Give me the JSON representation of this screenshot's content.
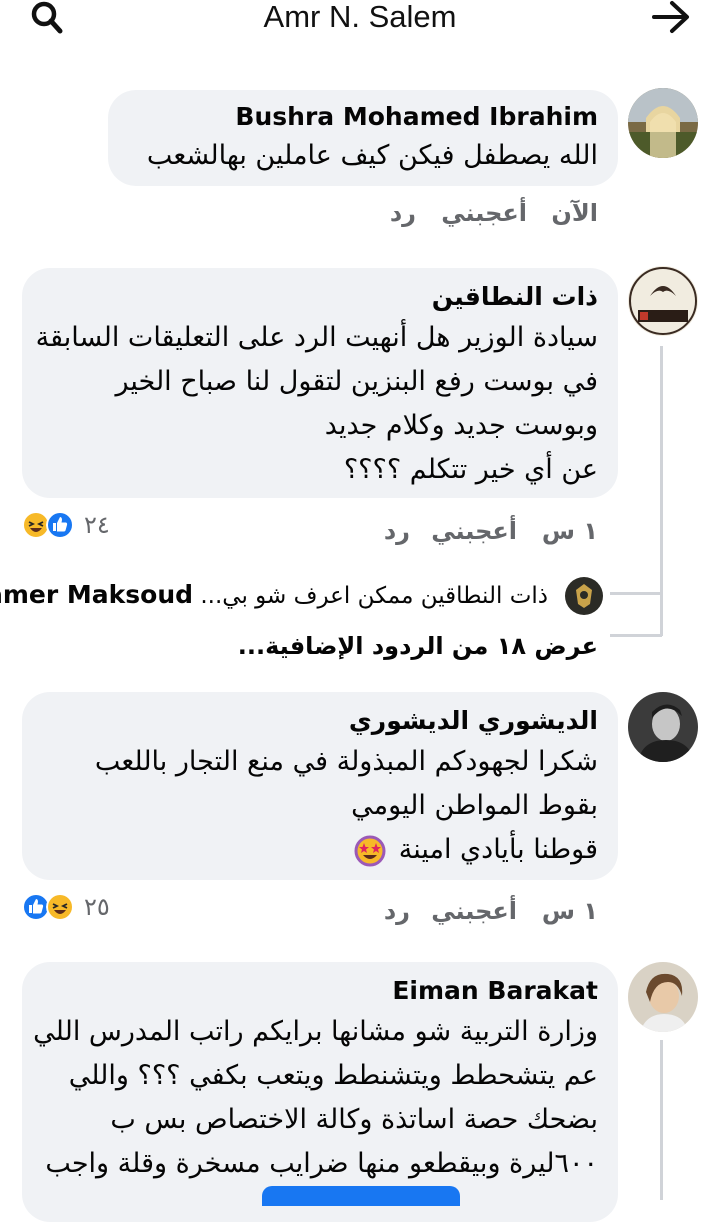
{
  "header": {
    "title": "Amr N. Salem"
  },
  "comments": [
    {
      "author": "Bushra Mohamed Ibrahim",
      "lines": [
        "الله يصطفل فيكن كيف عاملين بهالشعب"
      ],
      "time": "الآن",
      "like": "أعجبني",
      "reply": "رد"
    },
    {
      "author": "ذات النطاقين",
      "lines": [
        "سيادة الوزير هل أنهيت الرد على التعليقات السابقة",
        "في بوست رفع البنزين لتقول لنا صباح الخير",
        "وبوست جديد وكلام جديد",
        "عن أي خير تتكلم ؟؟؟؟"
      ],
      "time": "١ س",
      "like": "أعجبني",
      "reply": "رد",
      "reaction_count": "٢٤"
    },
    {
      "author": "الديشوري الديشوري",
      "lines": [
        "شكرا لجهودكم المبذولة في منع التجار باللعب",
        "بقوط المواطن اليومي",
        "قوطنا بأيادي امينة"
      ],
      "time": "١ س",
      "like": "أعجبني",
      "reply": "رد",
      "reaction_count": "٢٥"
    },
    {
      "author": "Eiman Barakat",
      "lines": [
        "وزارة التربية شو مشانها برايكم راتب المدرس اللي",
        "عم يتشحطط ويتشنطط ويتعب بكفي ؟؟؟ واللي",
        "بضحك حصة اساتذة وكالة الاختصاص بس ب",
        "٦٠٠ليرة وبيقطعو منها ضرايب مسخرة وقلة واجب"
      ]
    }
  ],
  "reply_preview": {
    "author": "Samer Maksoud",
    "text": "ذات النطاقين ممكن اعرف شو بي..."
  },
  "more_replies": "عرض ١٨ من الردود الإضافية...",
  "icons": {
    "search": "search-icon",
    "forward": "arrow-right-icon",
    "like": "like-reaction-icon",
    "haha": "haha-reaction-icon",
    "star_eyes": "star-struck-emoji-icon"
  },
  "colors": {
    "bubble": "#f0f2f5",
    "meta": "#65676b",
    "like_blue": "#1877f2",
    "haha_yellow": "#f7b928"
  }
}
